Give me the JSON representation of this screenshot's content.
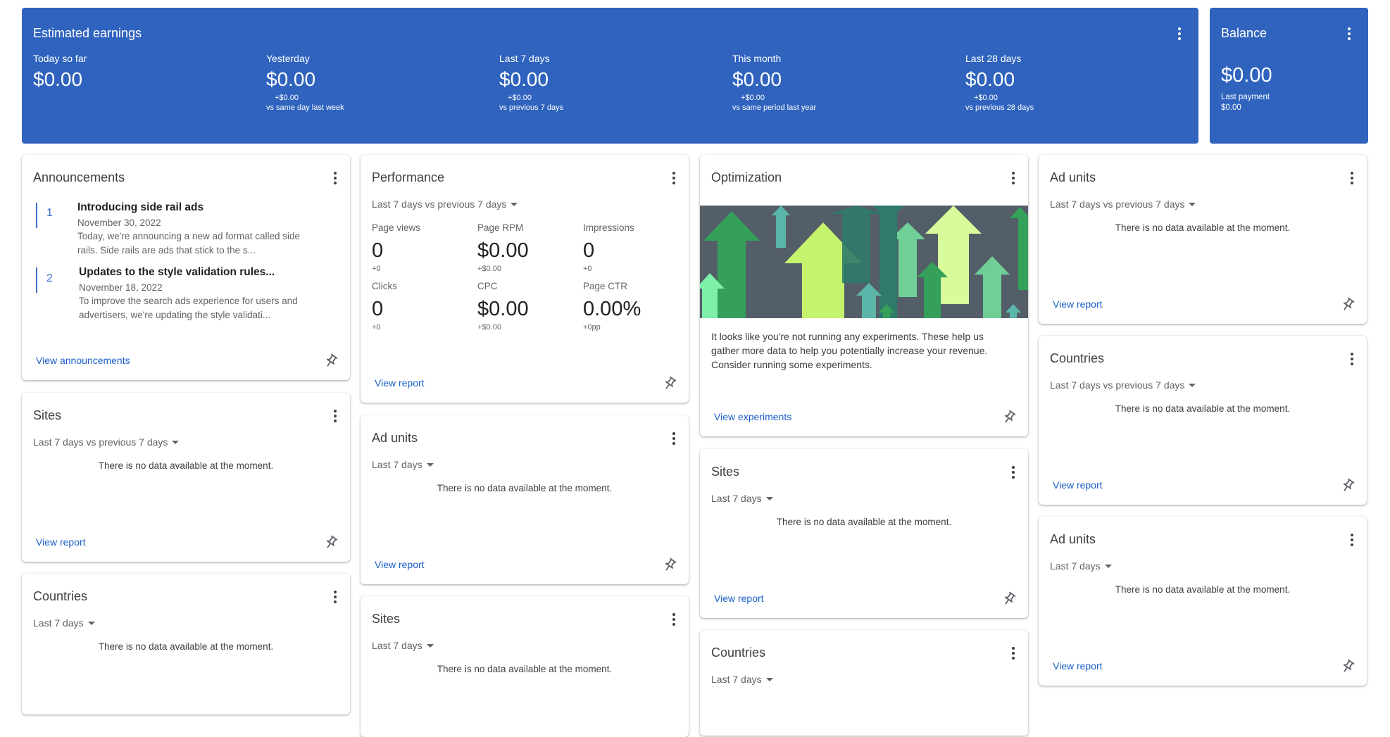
{
  "earnings": {
    "title": "Estimated earnings",
    "metrics": [
      {
        "label": "Today so far",
        "value": "$0.00",
        "delta": "",
        "comparison": ""
      },
      {
        "label": "Yesterday",
        "value": "$0.00",
        "delta": "+$0.00",
        "comparison": "vs same day last week"
      },
      {
        "label": "Last 7 days",
        "value": "$0.00",
        "delta": "+$0.00",
        "comparison": "vs previous 7 days"
      },
      {
        "label": "This month",
        "value": "$0.00",
        "delta": "+$0.00",
        "comparison": "vs same period last year"
      },
      {
        "label": "Last 28 days",
        "value": "$0.00",
        "delta": "+$0.00",
        "comparison": "vs previous 28 days"
      }
    ]
  },
  "balance": {
    "title": "Balance",
    "value": "$0.00",
    "last_payment_label": "Last payment",
    "last_payment_value": "$0.00"
  },
  "announcements": {
    "title": "Announcements",
    "items": [
      {
        "num": "1",
        "title": "Introducing side rail ads",
        "date": "November 30, 2022",
        "text1": "Today, we're announcing a new ad format called side",
        "text2": "rails. Side rails are ads that stick to the s..."
      },
      {
        "num": "2",
        "title": "Updates to the style validation rules...",
        "date": "November 18, 2022",
        "text1": "To improve the search ads experience for users and",
        "text2": "advertisers, we're updating the style validati..."
      }
    ],
    "link": "View announcements"
  },
  "performance": {
    "title": "Performance",
    "range": "Last 7 days vs previous 7 days",
    "metrics": [
      {
        "label": "Page views",
        "value": "0",
        "delta": "+0"
      },
      {
        "label": "Page RPM",
        "value": "$0.00",
        "delta": "+$0.00"
      },
      {
        "label": "Impressions",
        "value": "0",
        "delta": "+0"
      },
      {
        "label": "Clicks",
        "value": "0",
        "delta": "+0"
      },
      {
        "label": "CPC",
        "value": "$0.00",
        "delta": "+$0.00"
      },
      {
        "label": "Page CTR",
        "value": "0.00%",
        "delta": "+0pp"
      }
    ],
    "link": "View report"
  },
  "optimization": {
    "title": "Optimization",
    "text1": "It looks like you're not running any experiments. These help us",
    "text2": "gather more data to help you potentially increase your revenue.",
    "text3": "Consider running some experiments.",
    "link": "View experiments"
  },
  "cards": {
    "sites_col1": {
      "title": "Sites",
      "range": "Last 7 days vs previous 7 days",
      "nodata": "There is no data available at the moment.",
      "link": "View report"
    },
    "countries_col1": {
      "title": "Countries",
      "range": "Last 7 days",
      "nodata": "There is no data available at the moment."
    },
    "adunits_col2": {
      "title": "Ad units",
      "range": "Last 7 days",
      "nodata": "There is no data available at the moment.",
      "link": "View report"
    },
    "sites_col2": {
      "title": "Sites",
      "range": "Last 7 days",
      "nodata": "There is no data available at the moment."
    },
    "sites_col3": {
      "title": "Sites",
      "range": "Last 7 days",
      "nodata": "There is no data available at the moment.",
      "link": "View report"
    },
    "countries_col3": {
      "title": "Countries",
      "range": "Last 7 days"
    },
    "adunits_col4a": {
      "title": "Ad units",
      "range": "Last 7 days vs previous 7 days",
      "nodata": "There is no data available at the moment.",
      "link": "View report"
    },
    "countries_col4": {
      "title": "Countries",
      "range": "Last 7 days vs previous 7 days",
      "nodata": "There is no data available at the moment.",
      "link": "View report"
    },
    "adunits_col4b": {
      "title": "Ad units",
      "range": "Last 7 days",
      "nodata": "There is no data available at the moment.",
      "link": "View report"
    }
  },
  "icons": {
    "menu": "more-vert-icon",
    "pin": "pin-icon",
    "dropdown": "caret-down-icon"
  },
  "colors": {
    "header_blue": "#2f63be",
    "link_blue": "#1a5fc7",
    "arrow_lime": "#c6f36d",
    "arrow_green": "#34a05a",
    "arrow_teal": "#2f7a6a",
    "image_bg": "#535e68"
  }
}
